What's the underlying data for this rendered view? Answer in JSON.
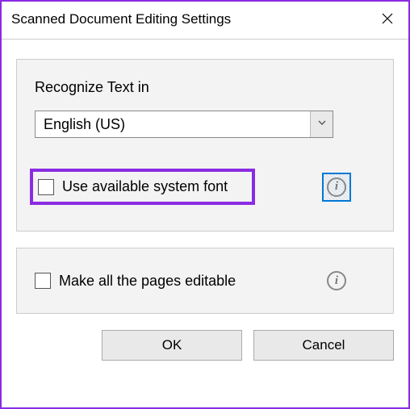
{
  "titlebar": {
    "title": "Scanned Document Editing Settings"
  },
  "panel1": {
    "recognize_label": "Recognize Text in",
    "language_selected": "English (US)",
    "system_font_label": "Use available system font"
  },
  "panel2": {
    "all_pages_label": "Make all the pages editable"
  },
  "buttons": {
    "ok": "OK",
    "cancel": "Cancel"
  },
  "icons": {
    "info": "i"
  }
}
